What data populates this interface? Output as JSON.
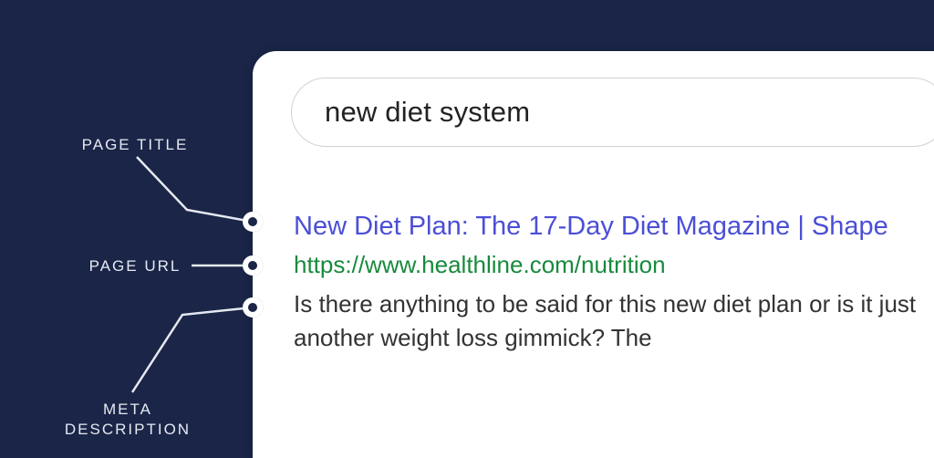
{
  "labels": {
    "page_title": "PAGE TITLE",
    "page_url": "PAGE URL",
    "meta_description": "META\nDESCRIPTION"
  },
  "search": {
    "query": "new diet system"
  },
  "result": {
    "title": "New Diet Plan: The 17-Day Diet Magazine | Shape",
    "url": "https://www.healthline.com/nutrition",
    "description": "Is there anything to be said for this new diet plan or is it just another weight loss gimmick? The"
  }
}
